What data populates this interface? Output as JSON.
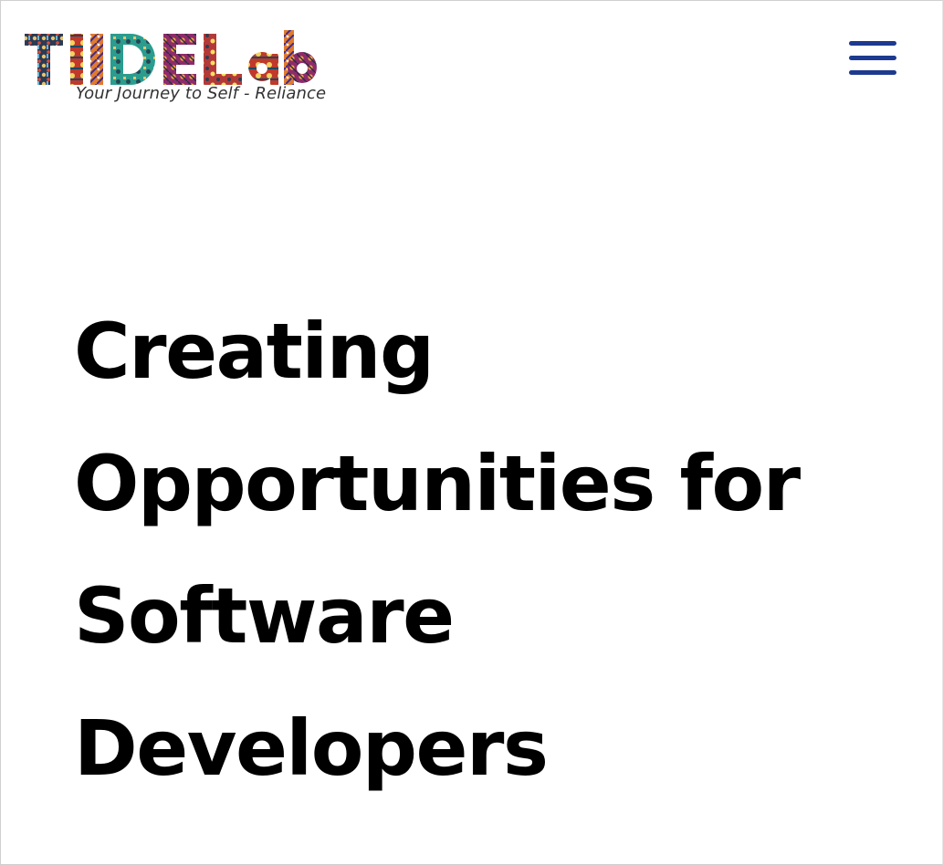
{
  "header": {
    "logo_text": "TIIDELab",
    "tagline": "Your Journey to Self - Reliance",
    "menu_icon": "hamburger-menu-icon",
    "menu_color": "#1d3a8f"
  },
  "hero": {
    "lines": [
      "Creating",
      "Opportunities for",
      "Software",
      "Developers"
    ]
  }
}
